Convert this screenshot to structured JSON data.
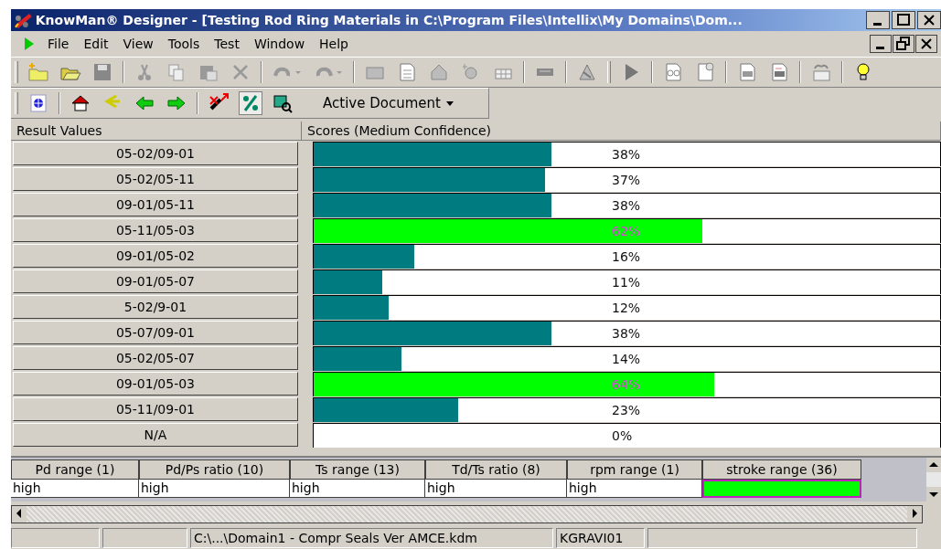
{
  "window": {
    "title": "KnowMan® Designer - [Testing Rod Ring Materials in C:\\Program Files\\Intellix\\My Domains\\Dom..."
  },
  "menu": [
    "File",
    "Edit",
    "View",
    "Tools",
    "Test",
    "Window",
    "Help"
  ],
  "toolbar2": {
    "dropdown": "Active Document",
    "percent_selected": true
  },
  "results": {
    "columns": [
      "Result Values",
      "Scores  (Medium Confidence)"
    ],
    "rows": [
      {
        "label": "05-02/09-01",
        "level": 0.38,
        "reading": "38%",
        "best": false
      },
      {
        "label": "05-02/05-11",
        "level": 0.37,
        "reading": "37%",
        "best": false
      },
      {
        "label": "09-01/05-11",
        "level": 0.38,
        "reading": "38%",
        "best": false
      },
      {
        "label": "05-11/05-03",
        "level": 0.62,
        "reading": "62%",
        "best": true
      },
      {
        "label": "09-01/05-02",
        "level": 0.16,
        "reading": "16%",
        "best": false
      },
      {
        "label": "09-01/05-07",
        "level": 0.11,
        "reading": "11%",
        "best": false
      },
      {
        "label": "5-02/9-01",
        "level": 0.12,
        "reading": "12%",
        "best": false
      },
      {
        "label": "05-07/09-01",
        "level": 0.38,
        "reading": "38%",
        "best": false
      },
      {
        "label": "05-02/05-07",
        "level": 0.14,
        "reading": "14%",
        "best": false
      },
      {
        "label": "09-01/05-03",
        "level": 0.64,
        "reading": "64%",
        "best": true
      },
      {
        "label": "05-11/09-01",
        "level": 0.23,
        "reading": "23%",
        "best": false
      },
      {
        "label": "N/A",
        "level": 0,
        "reading": "0%",
        "best": false
      }
    ]
  },
  "attributes": {
    "columns": [
      "Pd range (1)",
      "Pd/Ps ratio (10)",
      "Ts range (13)",
      "Td/Ts ratio (8)",
      "rpm range (1)",
      "stroke range (36)"
    ],
    "cells": [
      {
        "text": "high",
        "highlighted": false
      },
      {
        "text": "high",
        "highlighted": false
      },
      {
        "text": "high",
        "highlighted": false
      },
      {
        "text": "high",
        "highlighted": false
      },
      {
        "text": "high",
        "highlighted": false
      },
      {
        "highlighted": true
      }
    ]
  },
  "status_bar": {
    "file": "C:\\...\\Domain1 - Compr Seals Ver AMCE.kdm",
    "user": "KGRAVI01"
  }
}
